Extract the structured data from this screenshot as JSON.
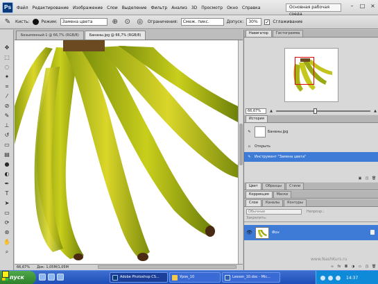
{
  "app": {
    "logo": "Ps",
    "menu": [
      "Файл",
      "Редактирование",
      "Изображение",
      "Слои",
      "Выделение",
      "Фильтр",
      "Анализ",
      "3D",
      "Просмотр",
      "Окно",
      "Справка"
    ],
    "workspace": "Основная рабочая среда"
  },
  "options": {
    "brush_label": "Кисть:",
    "mode_label": "Режим:",
    "mode_value": "Замена цвета",
    "limits_label": "Ограничения:",
    "limits_value": "Смеж. пикс.",
    "tolerance_label": "Допуск:",
    "tolerance_value": "30%",
    "antialias_label": "Сглаживание"
  },
  "document": {
    "tabs": [
      "Безымянный-1 @ 66,7% (RGB/8)",
      "Бананы.jpg @ 66,7% (RGB/8)"
    ],
    "active_tab": 1,
    "zoom": "66,67%",
    "doc_info": "Док: 1,05M/1,05M"
  },
  "panels": {
    "navigator": {
      "tabs": [
        "Навигатор",
        "Гистограмма"
      ],
      "zoom": "66,67%"
    },
    "history": {
      "tabs": [
        "История"
      ],
      "items": [
        "Бананы.jpg",
        "Открыть",
        "Инструмент \"Замена цвета\""
      ]
    },
    "layers": {
      "group1_tabs": [
        "Цвет",
        "Образцы",
        "Стили"
      ],
      "group2_tabs": [
        "Коррекция",
        "Маски"
      ],
      "tabs": [
        "Слои",
        "Каналы",
        "Контуры"
      ],
      "blend_mode": "Обычные",
      "opacity_label": "Непрозр.:",
      "lock_label": "Закрепить:",
      "layer_name": "Фон"
    }
  },
  "watermark": "www.NashKurs.ru",
  "taskbar": {
    "start": "пуск",
    "tasks": [
      "Adobe Photoshop CS...",
      "Урок_10",
      "Lesson_10.doc - Mic..."
    ],
    "active_task": 0,
    "clock": "14:37"
  },
  "colors": {
    "foreground": "#f7ee1c",
    "background": "#ffffff",
    "selection": "#3d7bd6",
    "taskbar": "#245edb"
  }
}
